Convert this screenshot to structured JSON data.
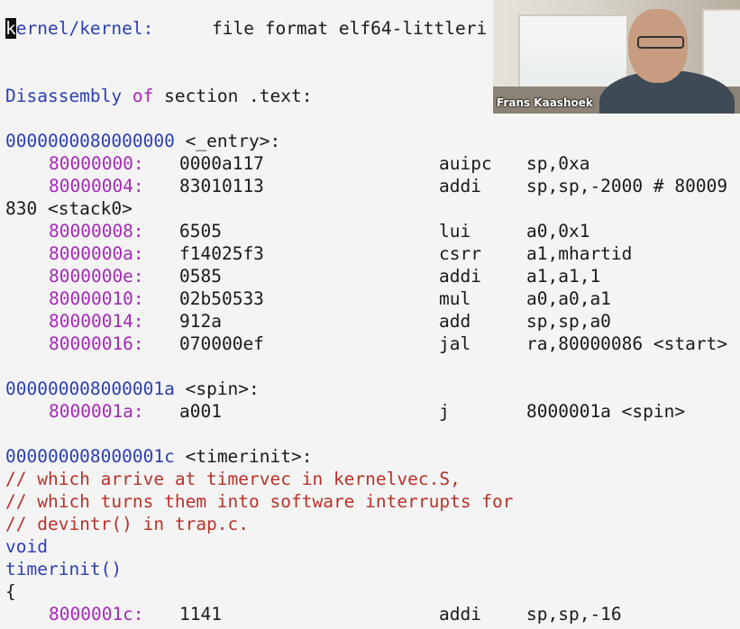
{
  "header": {
    "cursor_char": "k",
    "path_rest": "ernel/kernel:",
    "format_text": "file format elf64-littleri"
  },
  "section": {
    "word1": "Disassembly",
    "word2": "of",
    "word3": "section .text:"
  },
  "entry_block": {
    "symbol_addr": "0000000080000000",
    "symbol_name": "<_entry>:",
    "instr1": {
      "addr": "80000000:",
      "hex": "0000a117",
      "op": "auipc",
      "args": "sp,0xa"
    },
    "instr2": {
      "addr": "80000004:",
      "hex": "83010113",
      "op": "addi",
      "args": "sp,sp,-2000 # 80009"
    },
    "wrap_text": "830 <stack0>",
    "instr3": {
      "addr": "80000008:",
      "hex": "6505",
      "op": "lui",
      "args": "a0,0x1"
    },
    "instr4": {
      "addr": "8000000a:",
      "hex": "f14025f3",
      "op": "csrr",
      "args": "a1,mhartid"
    },
    "instr5": {
      "addr": "8000000e:",
      "hex": "0585",
      "op": "addi",
      "args": "a1,a1,1"
    },
    "instr6": {
      "addr": "80000010:",
      "hex": "02b50533",
      "op": "mul",
      "args": "a0,a0,a1"
    },
    "instr7": {
      "addr": "80000014:",
      "hex": "912a",
      "op": "add",
      "args": "sp,sp,a0"
    },
    "instr8": {
      "addr": "80000016:",
      "hex": "070000ef",
      "op": "jal",
      "args": "ra,80000086 <start>"
    }
  },
  "spin_block": {
    "symbol_addr": "000000008000001a",
    "symbol_name": "<spin>:",
    "instr1": {
      "addr": "8000001a:",
      "hex": "a001",
      "op": "j",
      "args": "8000001a <spin>"
    }
  },
  "timerinit_block": {
    "symbol_addr": "000000008000001c",
    "symbol_name": "<timerinit>:",
    "comment1": "// which arrive at timervec in kernelvec.S,",
    "comment2": "// which turns them into software interrupts for",
    "comment3": "// devintr() in trap.c.",
    "src1": "void",
    "src2": "timerinit()",
    "src3": "{",
    "instr1": {
      "addr": "8000001c:",
      "hex": "1141",
      "op": "addi",
      "args": "sp,sp,-16"
    }
  },
  "video": {
    "participant_name": "Frans Kaashoek"
  }
}
